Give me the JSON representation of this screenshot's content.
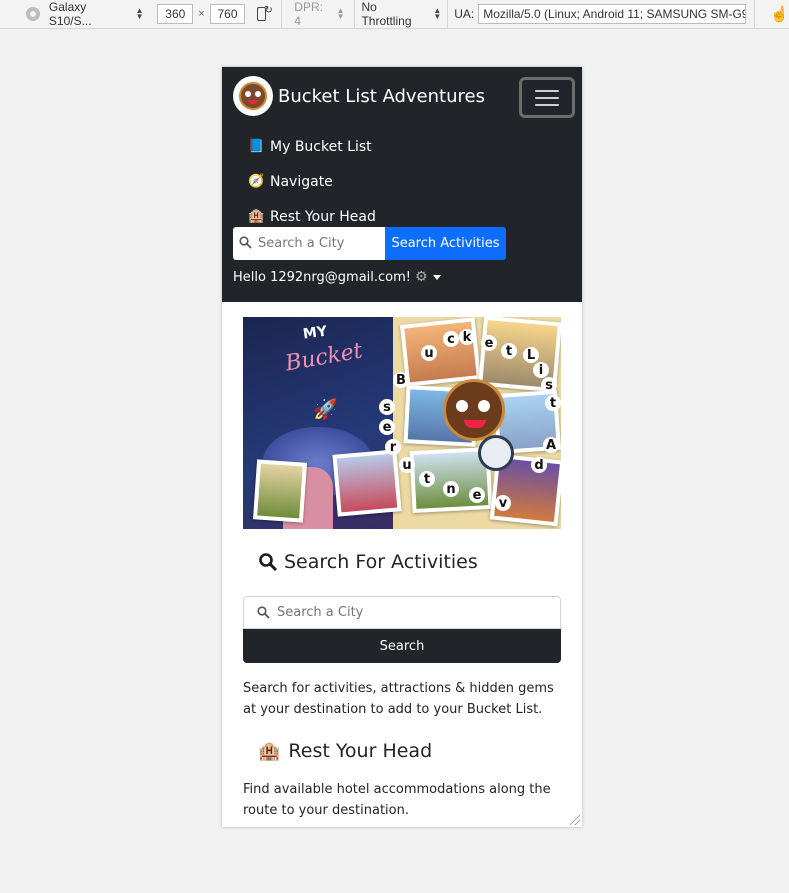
{
  "devtools": {
    "device": "Galaxy S10/S...",
    "width": "360",
    "height": "760",
    "dpr": "DPR: 4",
    "throttling": "No Throttling",
    "ua_label": "UA:",
    "ua_value": "Mozilla/5.0 (Linux; Android 11; SAMSUNG SM-G97",
    "times": "×"
  },
  "navbar": {
    "brand": "Bucket List Adventures",
    "links": [
      {
        "emoji": "📘",
        "label": "My Bucket List"
      },
      {
        "emoji": "🧭",
        "label": "Navigate"
      },
      {
        "emoji": "🏨",
        "label": "Rest Your Head"
      }
    ],
    "search_placeholder": "Search a City",
    "search_button": "Search Activities",
    "hello": "Hello 1292nrg@gmail.com!",
    "gear": "⚙"
  },
  "hero": {
    "my": "MY",
    "bucket": "Bucket",
    "letters": [
      "B",
      "u",
      "c",
      "k",
      "e",
      "t",
      "L",
      "i",
      "s",
      "t",
      "A",
      "d",
      "v",
      "e",
      "n",
      "t",
      "u",
      "r",
      "e",
      "s"
    ]
  },
  "main": {
    "search_heading": "Search For Activities",
    "search_placeholder": "Search a City",
    "search_button": "Search",
    "search_text": "Search for activities, attractions & hidden gems at your destination to add to your Bucket List.",
    "rest_emoji": "🏨",
    "rest_heading": "Rest Your Head",
    "rest_text": "Find available hotel accommodations along the route to your destination."
  },
  "colors": {
    "navbar_bg": "#212529",
    "primary_button": "#0d6efd",
    "dark_button": "#212529"
  }
}
